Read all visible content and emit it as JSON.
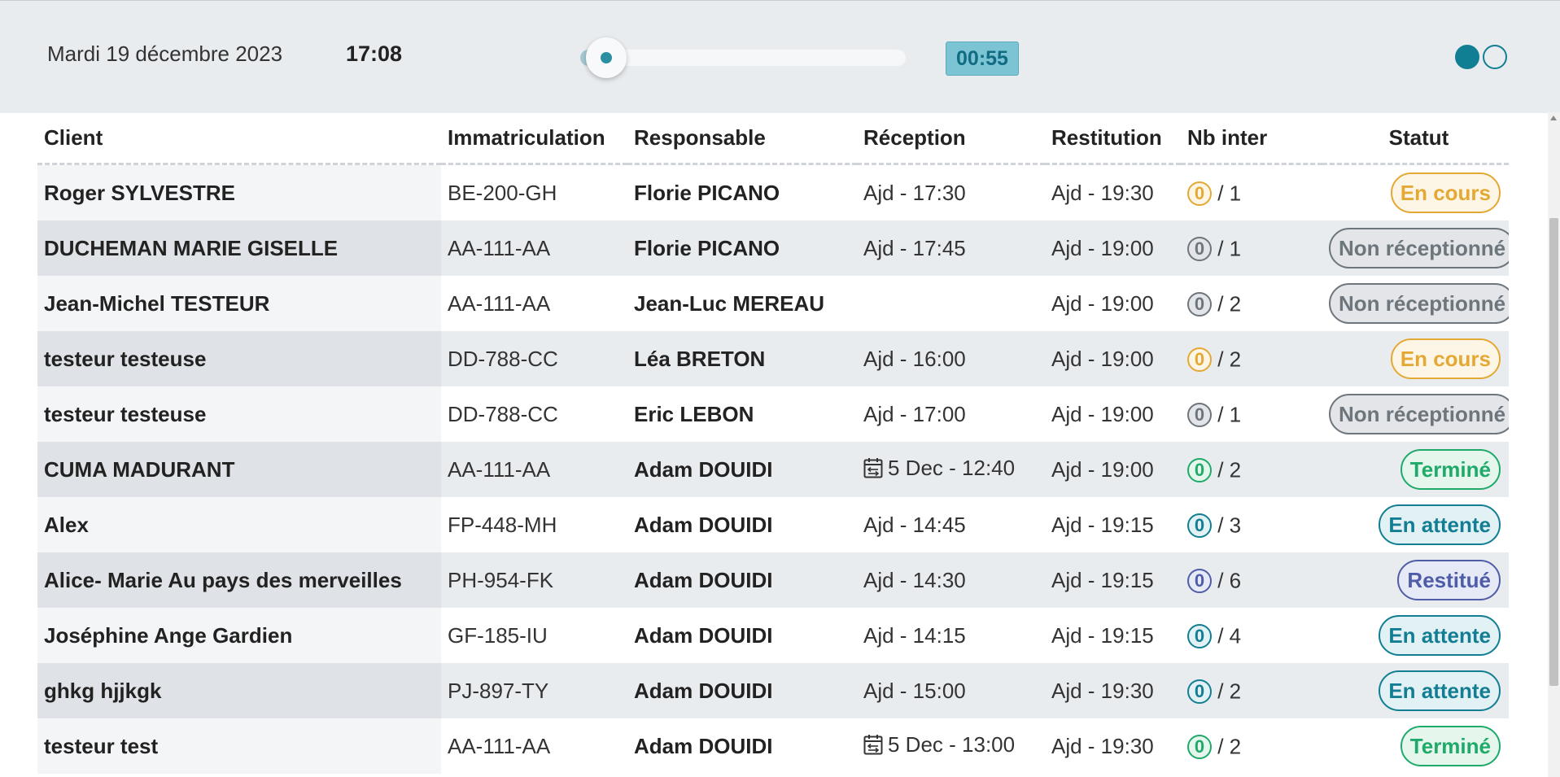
{
  "header": {
    "date": "Mardi 19 décembre 2023",
    "time": "17:08",
    "slider_level": 0.07,
    "timer": "00:55",
    "pager": {
      "pages": 2,
      "active": 1
    }
  },
  "columns": {
    "client": "Client",
    "immatriculation": "Immatriculation",
    "responsable": "Responsable",
    "reception": "Réception",
    "restitution": "Restitution",
    "nb_inter": "Nb inter",
    "statut": "Statut"
  },
  "rows": [
    {
      "client": "Roger SYLVESTRE",
      "plate": "BE-200-GH",
      "responsable": "Florie PICANO",
      "reception": "Ajd - 17:30",
      "reception_icon": "",
      "restitution": "Ajd - 19:30",
      "count": "0",
      "total": "/ 1",
      "status": "En cours",
      "status_class": "s-encours"
    },
    {
      "client": "DUCHEMAN MARIE GISELLE",
      "plate": "AA-111-AA",
      "responsable": "Florie PICANO",
      "reception": "Ajd - 17:45",
      "reception_icon": "",
      "restitution": "Ajd - 19:00",
      "count": "0",
      "total": "/ 1",
      "status": "Non réceptionné",
      "status_class": "s-nonrec"
    },
    {
      "client": "Jean-Michel TESTEUR",
      "plate": "AA-111-AA",
      "responsable": "Jean-Luc MEREAU",
      "reception": "",
      "reception_icon": "",
      "restitution": "Ajd - 19:00",
      "count": "0",
      "total": "/ 2",
      "status": "Non réceptionné",
      "status_class": "s-nonrec"
    },
    {
      "client": "testeur testeuse",
      "plate": "DD-788-CC",
      "responsable": "Léa BRETON",
      "reception": "Ajd - 16:00",
      "reception_icon": "",
      "restitution": "Ajd - 19:00",
      "count": "0",
      "total": "/ 2",
      "status": "En cours",
      "status_class": "s-encours"
    },
    {
      "client": "testeur testeuse",
      "plate": "DD-788-CC",
      "responsable": "Eric LEBON",
      "reception": "Ajd - 17:00",
      "reception_icon": "",
      "restitution": "Ajd - 19:00",
      "count": "0",
      "total": "/ 1",
      "status": "Non réceptionné",
      "status_class": "s-nonrec"
    },
    {
      "client": "CUMA MADURANT",
      "plate": "AA-111-AA",
      "responsable": "Adam DOUIDI",
      "reception": "5 Dec - 12:40",
      "reception_icon": "calendar-icon",
      "restitution": "Ajd - 19:00",
      "count": "0",
      "total": "/ 2",
      "status": "Terminé",
      "status_class": "s-termine"
    },
    {
      "client": "Alex",
      "plate": "FP-448-MH",
      "responsable": "Adam DOUIDI",
      "reception": "Ajd - 14:45",
      "reception_icon": "",
      "restitution": "Ajd - 19:15",
      "count": "0",
      "total": "/ 3",
      "status": "En attente",
      "status_class": "s-attente"
    },
    {
      "client": "Alice- Marie Au pays des merveilles",
      "plate": "PH-954-FK",
      "responsable": "Adam DOUIDI",
      "reception": "Ajd - 14:30",
      "reception_icon": "",
      "restitution": "Ajd - 19:15",
      "count": "0",
      "total": "/ 6",
      "status": "Restitué",
      "status_class": "s-restitue"
    },
    {
      "client": "Joséphine Ange Gardien",
      "plate": "GF-185-IU",
      "responsable": "Adam DOUIDI",
      "reception": "Ajd - 14:15",
      "reception_icon": "",
      "restitution": "Ajd - 19:15",
      "count": "0",
      "total": "/ 4",
      "status": "En attente",
      "status_class": "s-attente"
    },
    {
      "client": "ghkg hjjkgk",
      "plate": "PJ-897-TY",
      "responsable": "Adam DOUIDI",
      "reception": "Ajd - 15:00",
      "reception_icon": "",
      "restitution": "Ajd - 19:30",
      "count": "0",
      "total": "/ 2",
      "status": "En attente",
      "status_class": "s-attente"
    },
    {
      "client": "testeur test",
      "plate": "AA-111-AA",
      "responsable": "Adam DOUIDI",
      "reception": "5 Dec - 13:00",
      "reception_icon": "calendar-icon",
      "restitution": "Ajd - 19:30",
      "count": "0",
      "total": "/ 2",
      "status": "Terminé",
      "status_class": "s-termine"
    }
  ],
  "colors": {
    "accent": "#117f93",
    "en_cours": "#e3a934",
    "non_receptionne": "#6d757d",
    "termine": "#1faa6a",
    "en_attente": "#137e93",
    "restitue": "#4f5ca8"
  }
}
